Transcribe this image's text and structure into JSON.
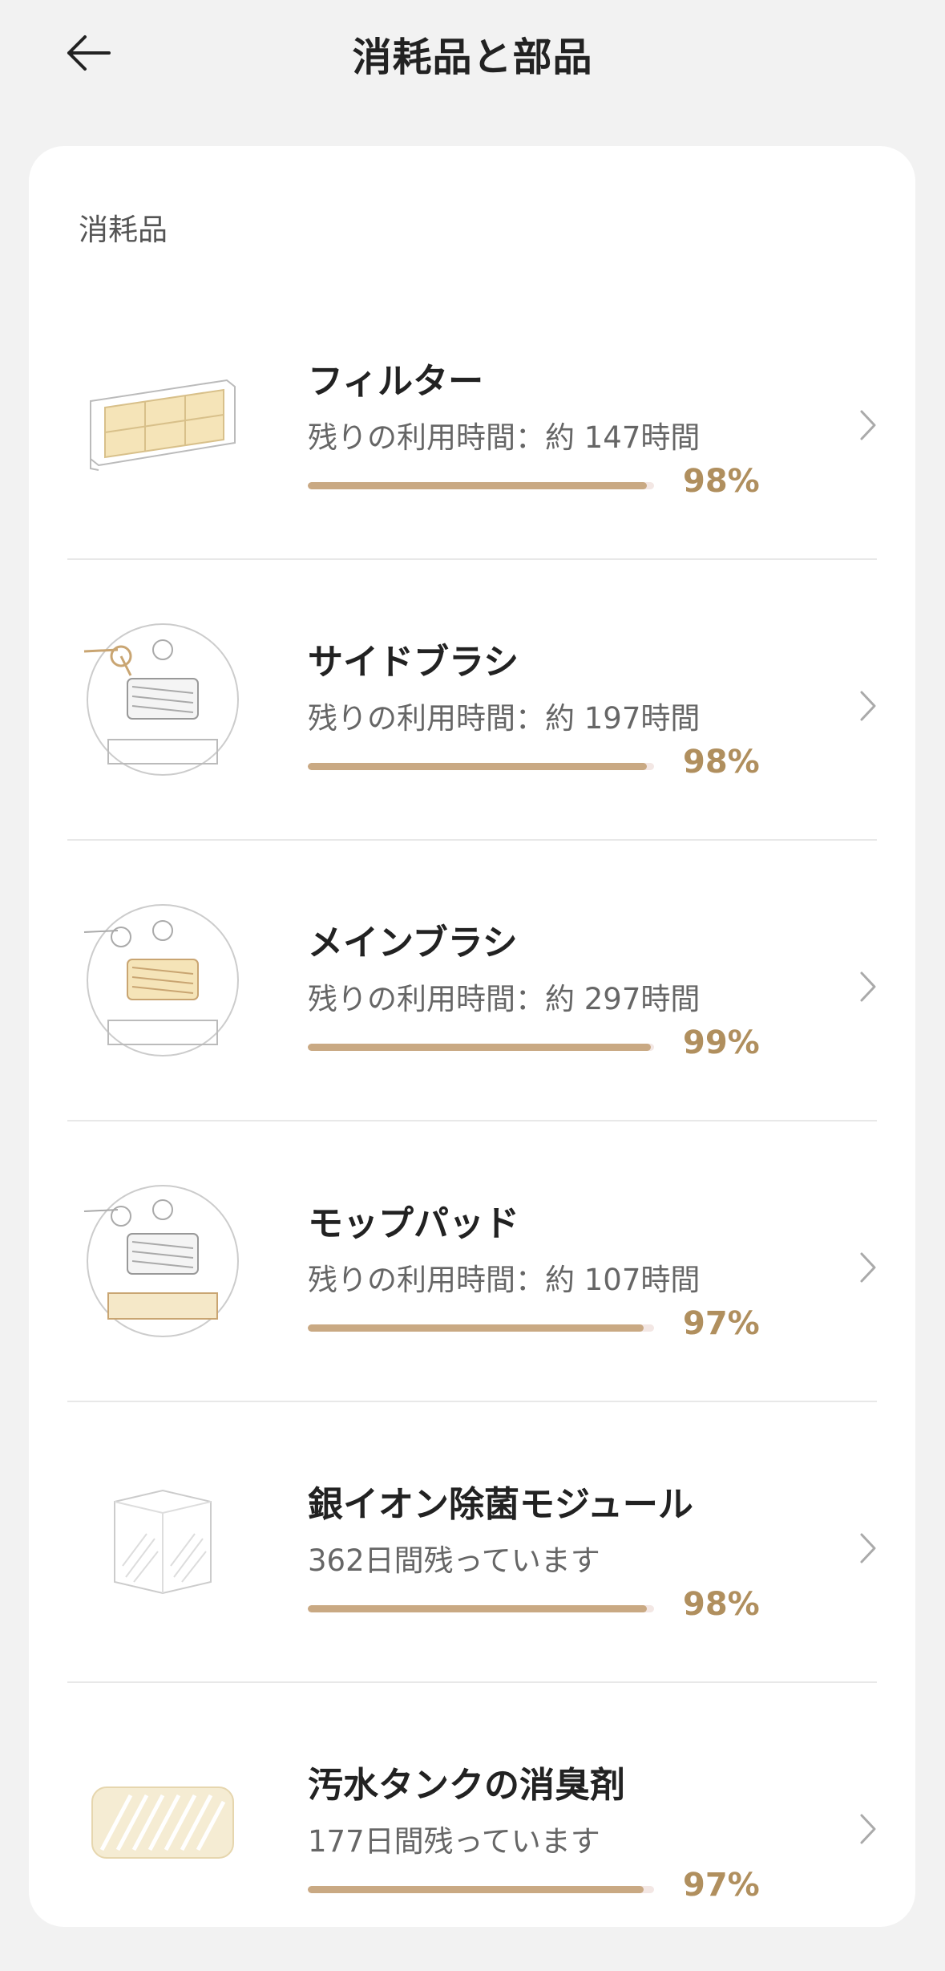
{
  "header": {
    "title": "消耗品と部品"
  },
  "section": {
    "label": "消耗品"
  },
  "items": [
    {
      "name": "フィルター",
      "remaining": "残りの利用時間：約 147時間",
      "percent_label": "98%",
      "percent": 98,
      "image": "filter-illustration"
    },
    {
      "name": "サイドブラシ",
      "remaining": "残りの利用時間：約 197時間",
      "percent_label": "98%",
      "percent": 98,
      "image": "robot-side-brush-illustration"
    },
    {
      "name": "メインブラシ",
      "remaining": "残りの利用時間：約 297時間",
      "percent_label": "99%",
      "percent": 99,
      "image": "robot-main-brush-illustration"
    },
    {
      "name": "モップパッド",
      "remaining": "残りの利用時間：約 107時間",
      "percent_label": "97%",
      "percent": 97,
      "image": "robot-mop-pad-illustration"
    },
    {
      "name": "銀イオン除菌モジュール",
      "remaining": "362日間残っています",
      "percent_label": "98%",
      "percent": 98,
      "image": "silver-ion-module-illustration"
    },
    {
      "name": "汚水タンクの消臭剤",
      "remaining": "177日間残っています",
      "percent_label": "97%",
      "percent": 97,
      "image": "deodorizer-illustration"
    }
  ],
  "colors": {
    "accent": "#b08f5e",
    "bar_fill": "#c9a983",
    "bar_track": "#f3e7e4",
    "card": "#ffffff",
    "background": "#f2f2f2"
  }
}
